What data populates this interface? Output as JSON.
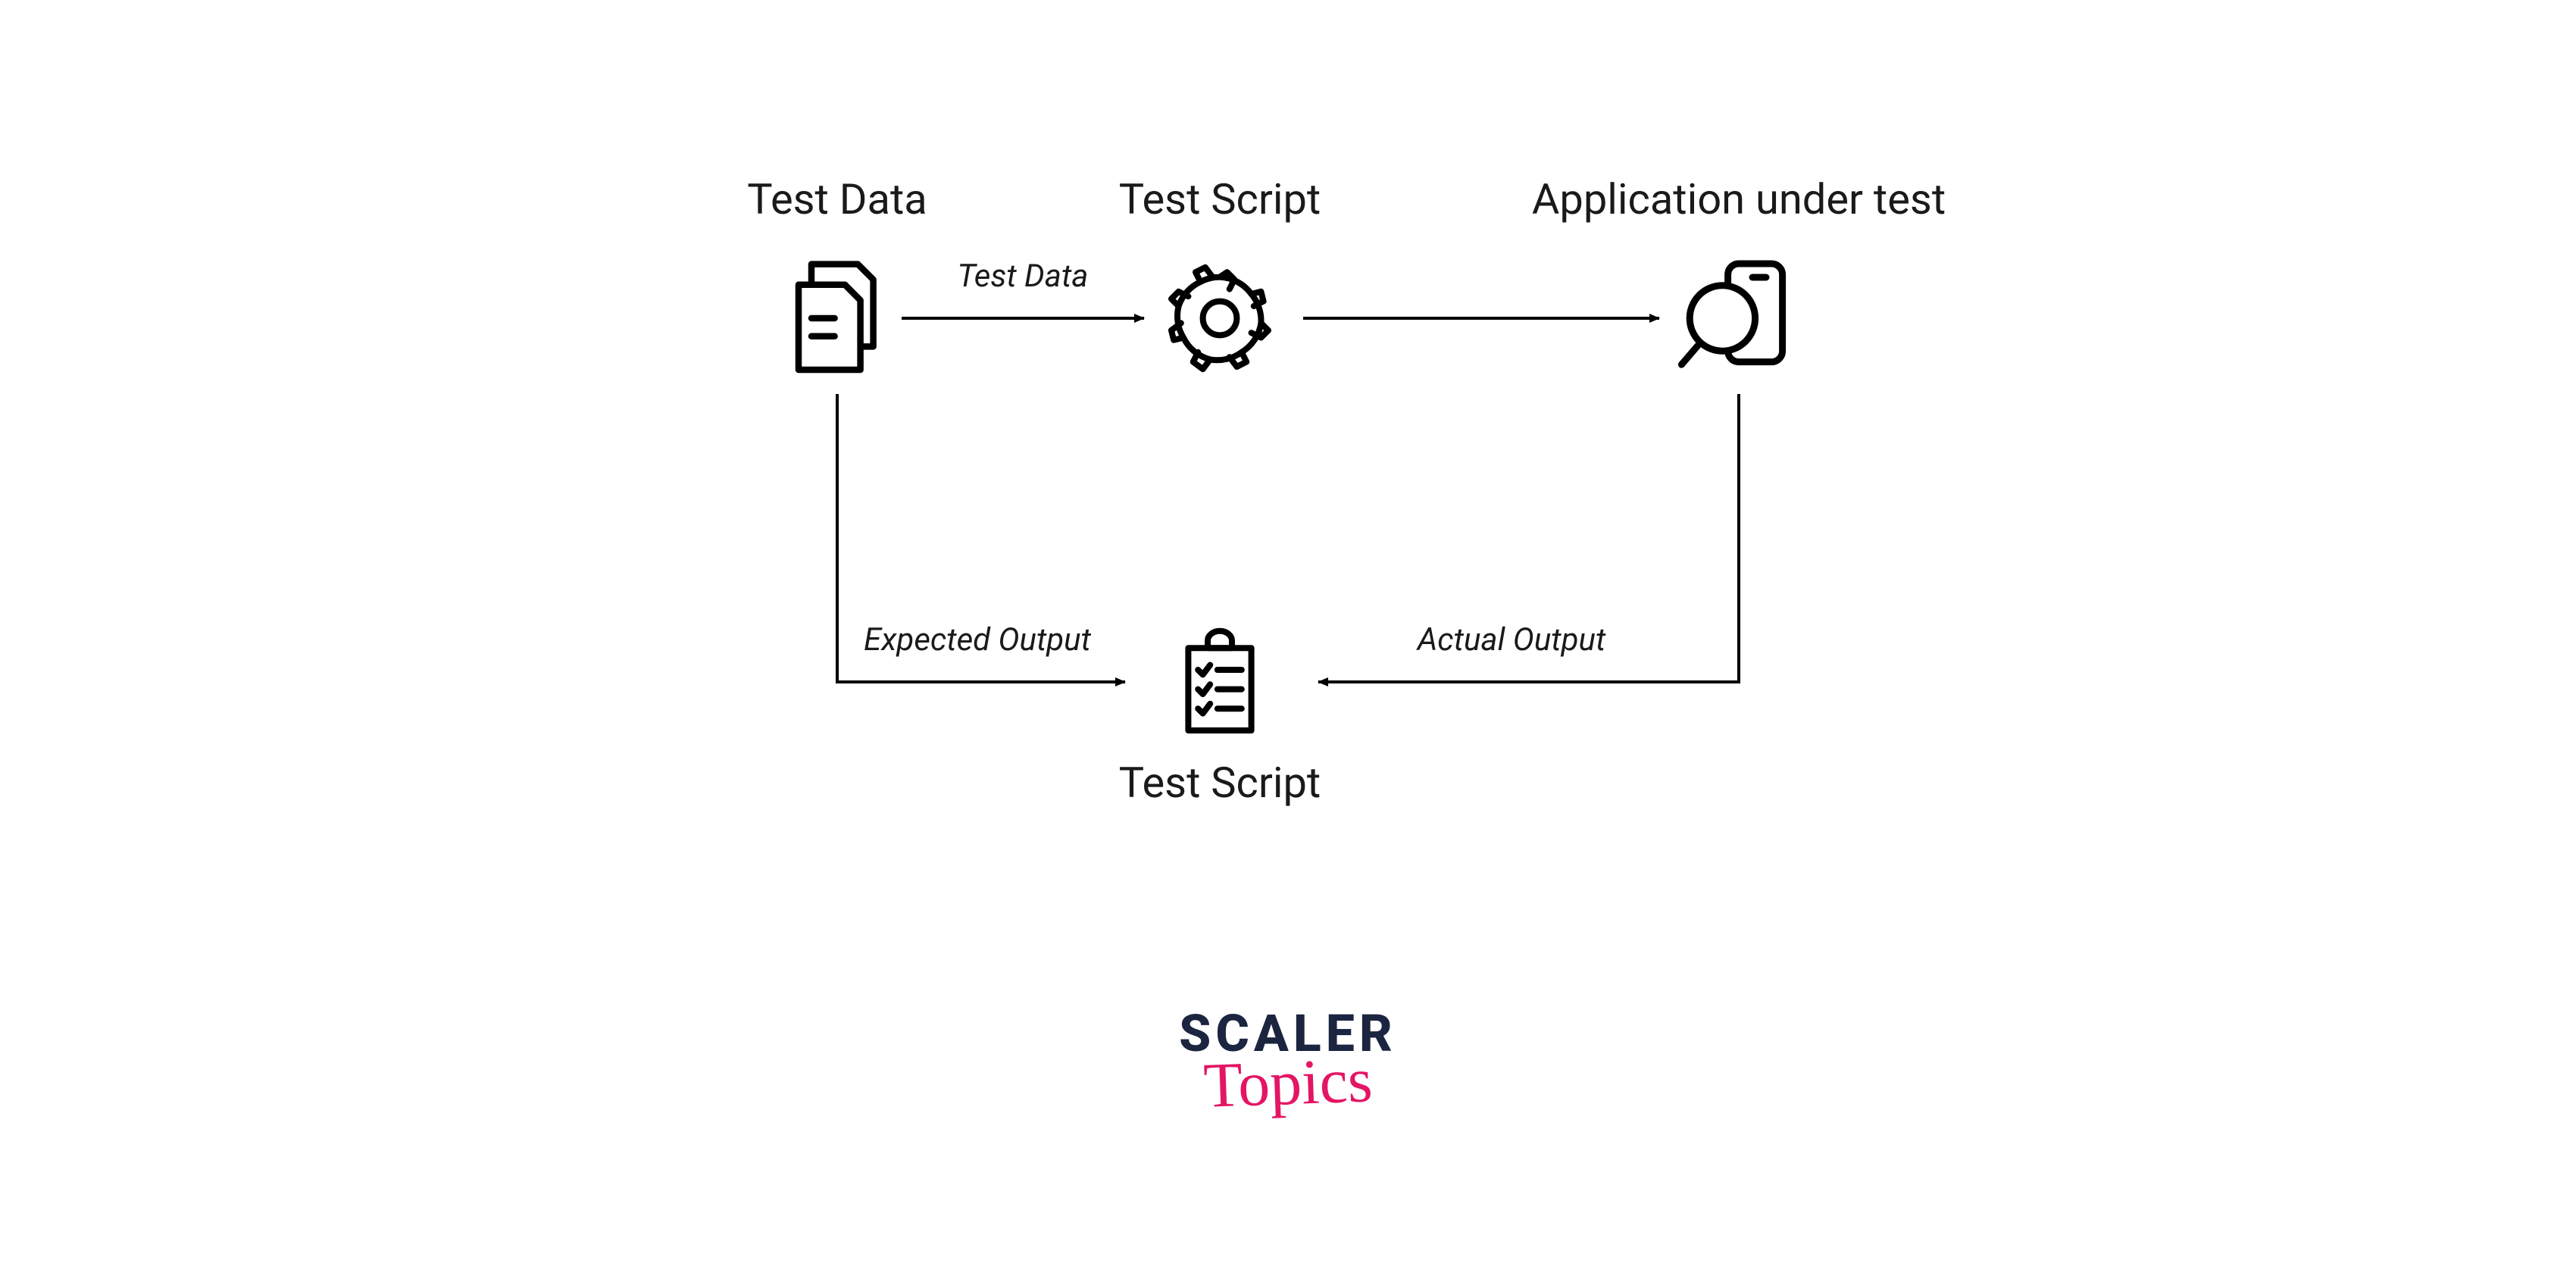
{
  "nodes": {
    "test_data": {
      "label": "Test Data",
      "icon": "documents-icon"
    },
    "test_script_top": {
      "label": "Test Script",
      "icon": "gear-icon"
    },
    "app_under_test": {
      "label": "Application under test",
      "icon": "app-inspect-icon"
    },
    "test_script_bottom": {
      "label": "Test Script",
      "icon": "checklist-icon"
    }
  },
  "edges": {
    "data_to_script": {
      "label": "Test Data"
    },
    "script_to_app": {
      "label": ""
    },
    "data_to_result": {
      "label": "Expected Output"
    },
    "app_to_result": {
      "label": "Actual Output"
    }
  },
  "brand": {
    "line1": "SCALER",
    "line2": "Topics"
  },
  "colors": {
    "ink": "#1a1a1a",
    "brand_dark": "#1b2540",
    "brand_pink": "#e41564"
  }
}
